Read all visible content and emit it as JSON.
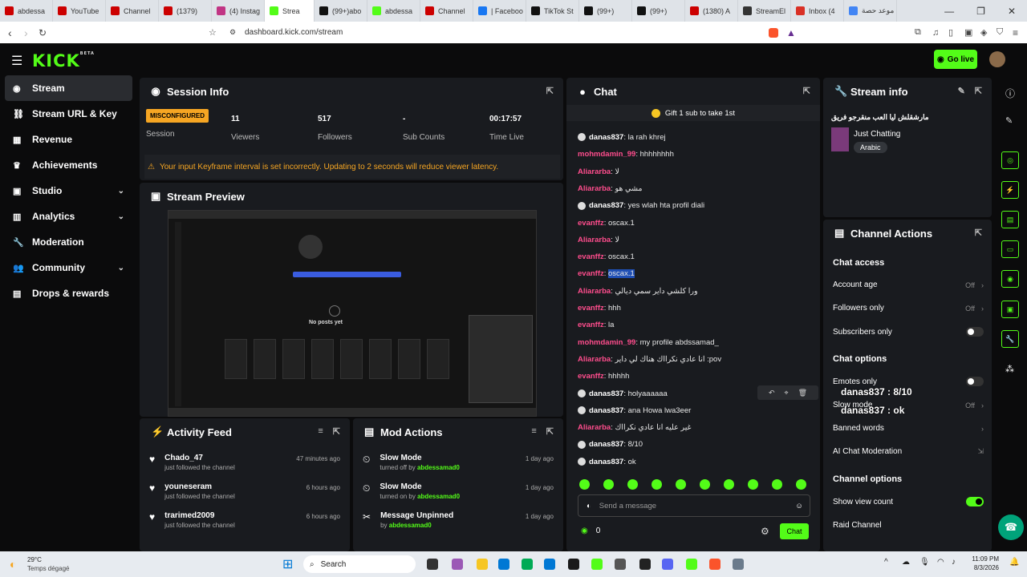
{
  "browser": {
    "tabs": [
      {
        "label": "abdessa",
        "color": "#cc0000"
      },
      {
        "label": "YouTube",
        "color": "#cc0000"
      },
      {
        "label": "Channel",
        "color": "#cc0000"
      },
      {
        "label": "(1379)",
        "color": "#cc0000"
      },
      {
        "label": "(4) Instag",
        "color": "#c13584"
      },
      {
        "label": "Strea",
        "color": "#53fc18",
        "active": true
      },
      {
        "label": "(99+)abo",
        "color": "#111111"
      },
      {
        "label": "abdessa",
        "color": "#53fc18"
      },
      {
        "label": "Channel",
        "color": "#cc0000"
      },
      {
        "label": "| Faceboo",
        "color": "#1877f2"
      },
      {
        "label": "TikTok St",
        "color": "#111111"
      },
      {
        "label": "(99+)",
        "color": "#111111"
      },
      {
        "label": "(99+)",
        "color": "#111111"
      },
      {
        "label": "(1380) A",
        "color": "#cc0000"
      },
      {
        "label": "StreamEl",
        "color": "#333333"
      },
      {
        "label": "Inbox (4",
        "color": "#d93025"
      },
      {
        "label": "موعد حصة",
        "color": "#4285f4"
      }
    ],
    "url": "dashboard.kick.com/stream"
  },
  "header": {
    "logo": "KICK",
    "logo_sup": "BETA",
    "go_live": "Go live"
  },
  "sidebar": {
    "items": [
      {
        "label": "Stream",
        "icon": "broadcast-icon"
      },
      {
        "label": "Stream URL & Key",
        "icon": "link-icon"
      },
      {
        "label": "Revenue",
        "icon": "chart-icon"
      },
      {
        "label": "Achievements",
        "icon": "trophy-icon"
      },
      {
        "label": "Studio",
        "icon": "studio-icon"
      },
      {
        "label": "Analytics",
        "icon": "analytics-icon"
      },
      {
        "label": "Moderation",
        "icon": "wrench-icon"
      },
      {
        "label": "Community",
        "icon": "people-icon"
      },
      {
        "label": "Drops & rewards",
        "icon": "gift-icon"
      }
    ]
  },
  "session": {
    "title": "Session Info",
    "status_badge": "MISCONFIGURED",
    "status_label": "Session",
    "viewers": "11",
    "viewers_label": "Viewers",
    "followers": "517",
    "followers_label": "Followers",
    "subs": "-",
    "subs_label": "Sub Counts",
    "time": "00:17:57",
    "time_label": "Time Live",
    "warning": "Your input Keyframe interval is set incorrectly. Updating to 2 seconds will reduce viewer latency."
  },
  "preview": {
    "title": "Stream Preview",
    "screen_text": "No posts yet"
  },
  "activity": {
    "title": "Activity Feed",
    "items": [
      {
        "name": "Chado_47",
        "sub": "just followed the channel",
        "time": "47 minutes ago"
      },
      {
        "name": "youneseram",
        "sub": "just followed the channel",
        "time": "6 hours ago"
      },
      {
        "name": "trarimed2009",
        "sub": "just followed the channel",
        "time": "6 hours ago"
      }
    ]
  },
  "mod": {
    "title": "Mod Actions",
    "items": [
      {
        "name": "Slow Mode",
        "sub": "turned off by",
        "by": "abdessamad0",
        "time": "1 day ago"
      },
      {
        "name": "Slow Mode",
        "sub": "turned on by",
        "by": "abdessamad0",
        "time": "1 day ago"
      },
      {
        "name": "Message Unpinned",
        "sub": "by",
        "by": "abdessamad0",
        "time": "1 day ago"
      }
    ]
  },
  "chat": {
    "title": "Chat",
    "banner": "Gift 1 sub to take 1st",
    "messages": [
      {
        "user": "danas837",
        "text": "la rah khrej",
        "style": "white",
        "avatar": true
      },
      {
        "user": "mohmdamin_99",
        "text": "hhhhhhhh",
        "style": "pink",
        "avatar": false
      },
      {
        "user": "Aliararba",
        "text": "لا",
        "style": "pink",
        "avatar": false
      },
      {
        "user": "Aliararba",
        "text": "مشي هو",
        "style": "pink",
        "avatar": false
      },
      {
        "user": "danas837",
        "text": "yes wlah hta profil diali",
        "style": "white",
        "avatar": true
      },
      {
        "user": "evanffz",
        "text": "oscax.1",
        "style": "pink",
        "avatar": false
      },
      {
        "user": "Aliararba",
        "text": "لا",
        "style": "pink",
        "avatar": false
      },
      {
        "user": "evanffz",
        "text": "oscax.1",
        "style": "pink",
        "avatar": false
      },
      {
        "user": "evanffz",
        "text": "oscax.1",
        "style": "pink",
        "avatar": false,
        "highlight": true
      },
      {
        "user": "Aliararba",
        "text": "ورا كلشي داير سمي ديالي",
        "style": "pink",
        "avatar": false
      },
      {
        "user": "evanffz",
        "text": "hhh",
        "style": "pink",
        "avatar": false
      },
      {
        "user": "evanffz",
        "text": "la",
        "style": "pink",
        "avatar": false
      },
      {
        "user": "mohmdamin_99",
        "text": "my profile abdssamad_",
        "style": "pink",
        "avatar": false
      },
      {
        "user": "Aliararba",
        "text": "انا عادي نكرااك هناك لي داير :pov",
        "style": "pink",
        "avatar": false
      },
      {
        "user": "evanffz",
        "text": "hhhhh",
        "style": "pink",
        "avatar": false
      },
      {
        "user": "danas837",
        "text": "holyaaaaaa",
        "style": "white",
        "avatar": true
      },
      {
        "user": "danas837",
        "text": "ana Howa lwa3eer",
        "style": "white",
        "avatar": true
      },
      {
        "user": "Aliararba",
        "text": "غير عليه انا عادي نكرااك",
        "style": "pink",
        "avatar": false
      },
      {
        "user": "danas837",
        "text": "8/10",
        "style": "white",
        "avatar": true
      },
      {
        "user": "danas837",
        "text": "ok",
        "style": "white",
        "avatar": true
      }
    ],
    "input_placeholder": "Send a message",
    "points": "0",
    "send_label": "Chat",
    "overlay_1": "danas837 : 8/10",
    "overlay_2": "danas837 : ok"
  },
  "stream_info": {
    "title": "Stream info",
    "stream_title": "مارشقلش ليا العب منقرجو فريق",
    "category": "Just Chatting",
    "tag": "Arabic"
  },
  "channel_actions": {
    "title": "Channel Actions",
    "chat_access": "Chat access",
    "account_age": "Account age",
    "account_age_val": "Off",
    "followers_only": "Followers only",
    "followers_only_val": "Off",
    "subscribers_only": "Subscribers only",
    "chat_options": "Chat options",
    "emotes_only": "Emotes only",
    "slow_mode": "Slow mode",
    "slow_mode_val": "Off",
    "banned_words": "Banned words",
    "ai_moderation": "AI Chat Moderation",
    "channel_options": "Channel options",
    "show_view_count": "Show view count",
    "raid_channel": "Raid Channel"
  },
  "taskbar": {
    "weather_temp": "29°C",
    "weather_desc": "Temps dégagé",
    "search": "Search",
    "time": "11:09 PM",
    "date": "8/3/2026"
  }
}
